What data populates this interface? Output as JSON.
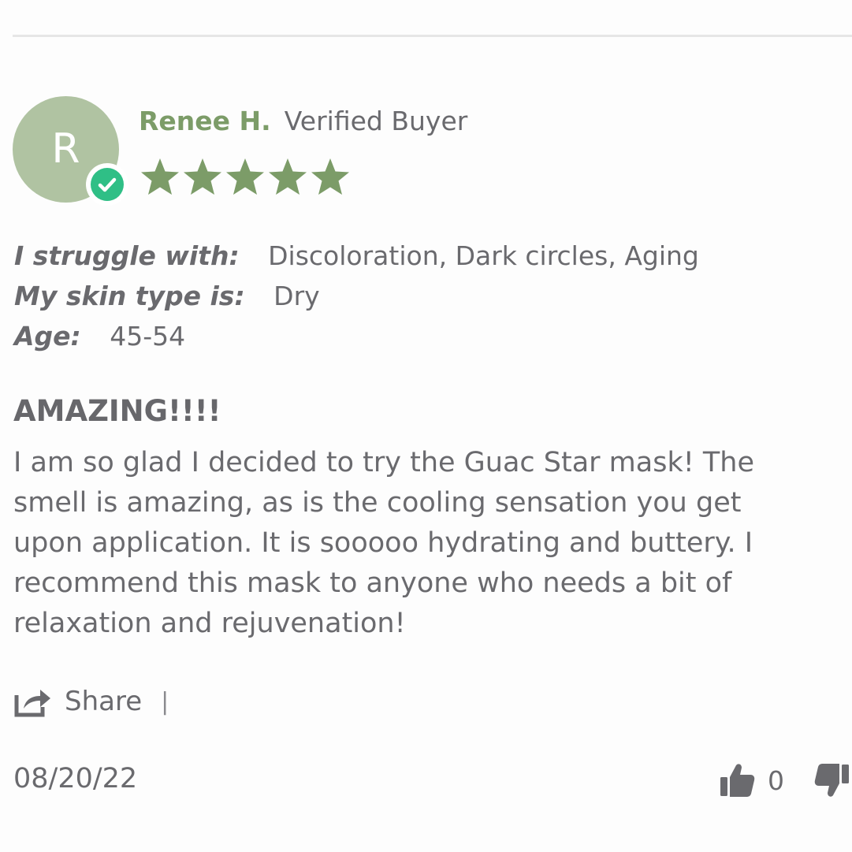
{
  "reviewer": {
    "initial": "R",
    "name": "Renee H.",
    "badge": "Verified Buyer",
    "rating": 5,
    "star_color": "#7c9c68"
  },
  "attributes": [
    {
      "label": "I struggle with:",
      "value": "Discoloration, Dark circles, Aging"
    },
    {
      "label": "My skin type is:",
      "value": "Dry"
    },
    {
      "label": "Age:",
      "value": "45-54"
    }
  ],
  "review": {
    "title": "AMAZING!!!!",
    "body_lines": [
      "I am so glad I decided to try the Guac Star mask! The",
      "smell is amazing, as is the cooling sensation you get",
      "upon application. It is sooooo hydrating and buttery. I",
      "recommend this mask to anyone who needs a bit of",
      "relaxation and rejuvenation!"
    ]
  },
  "actions": {
    "share_label": "Share",
    "separator": "|",
    "share_icon": "share-icon"
  },
  "footer": {
    "date": "08/20/22",
    "thumbs_up_count": "0",
    "thumbs_up_icon": "thumbs-up-icon",
    "thumbs_down_icon": "thumbs-down-icon"
  },
  "colors": {
    "avatar_bg": "#b0c3a2",
    "verified_badge": "#2fbf86",
    "name_green": "#7c9c68",
    "text_gray": "#6a6a6e"
  }
}
